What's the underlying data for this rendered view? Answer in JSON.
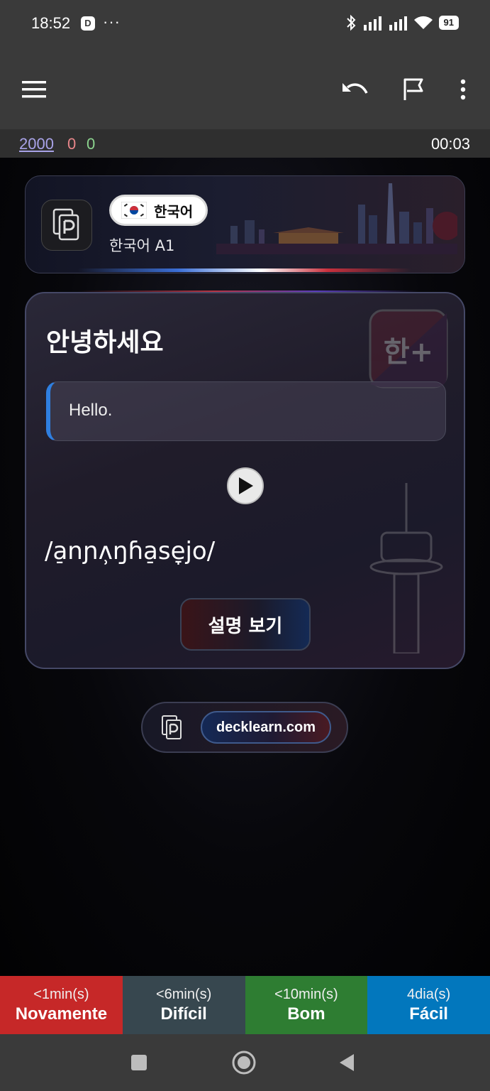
{
  "status_bar": {
    "time": "18:52",
    "app_badge": "D",
    "dots": "···",
    "battery": "91"
  },
  "toolbar": {
    "icons": [
      "menu-icon",
      "undo-icon",
      "flag-icon",
      "more-vert-icon"
    ]
  },
  "counts": {
    "new": "2000",
    "learning": "0",
    "review": "0",
    "timer": "00:03"
  },
  "deck": {
    "language": "한국어",
    "name": "한국어 A1"
  },
  "card": {
    "word": "안녕하세요",
    "meaning": "Hello.",
    "ipa": "/a̠nɲʌ̹ŋɦa̠se̞jo/",
    "explain_label": "설명 보기",
    "watermark_text": "한+"
  },
  "footer": {
    "site": "decklearn.com"
  },
  "answers": [
    {
      "time": "<1min(s)",
      "label": "Novamente"
    },
    {
      "time": "<6min(s)",
      "label": "Difícil"
    },
    {
      "time": "<10min(s)",
      "label": "Bom"
    },
    {
      "time": "4dia(s)",
      "label": "Fácil"
    }
  ],
  "colors": {
    "again": "#c62828",
    "hard": "#37474f",
    "good": "#2e7d32",
    "easy": "#0277bd",
    "accent": "#2f7fe0"
  }
}
